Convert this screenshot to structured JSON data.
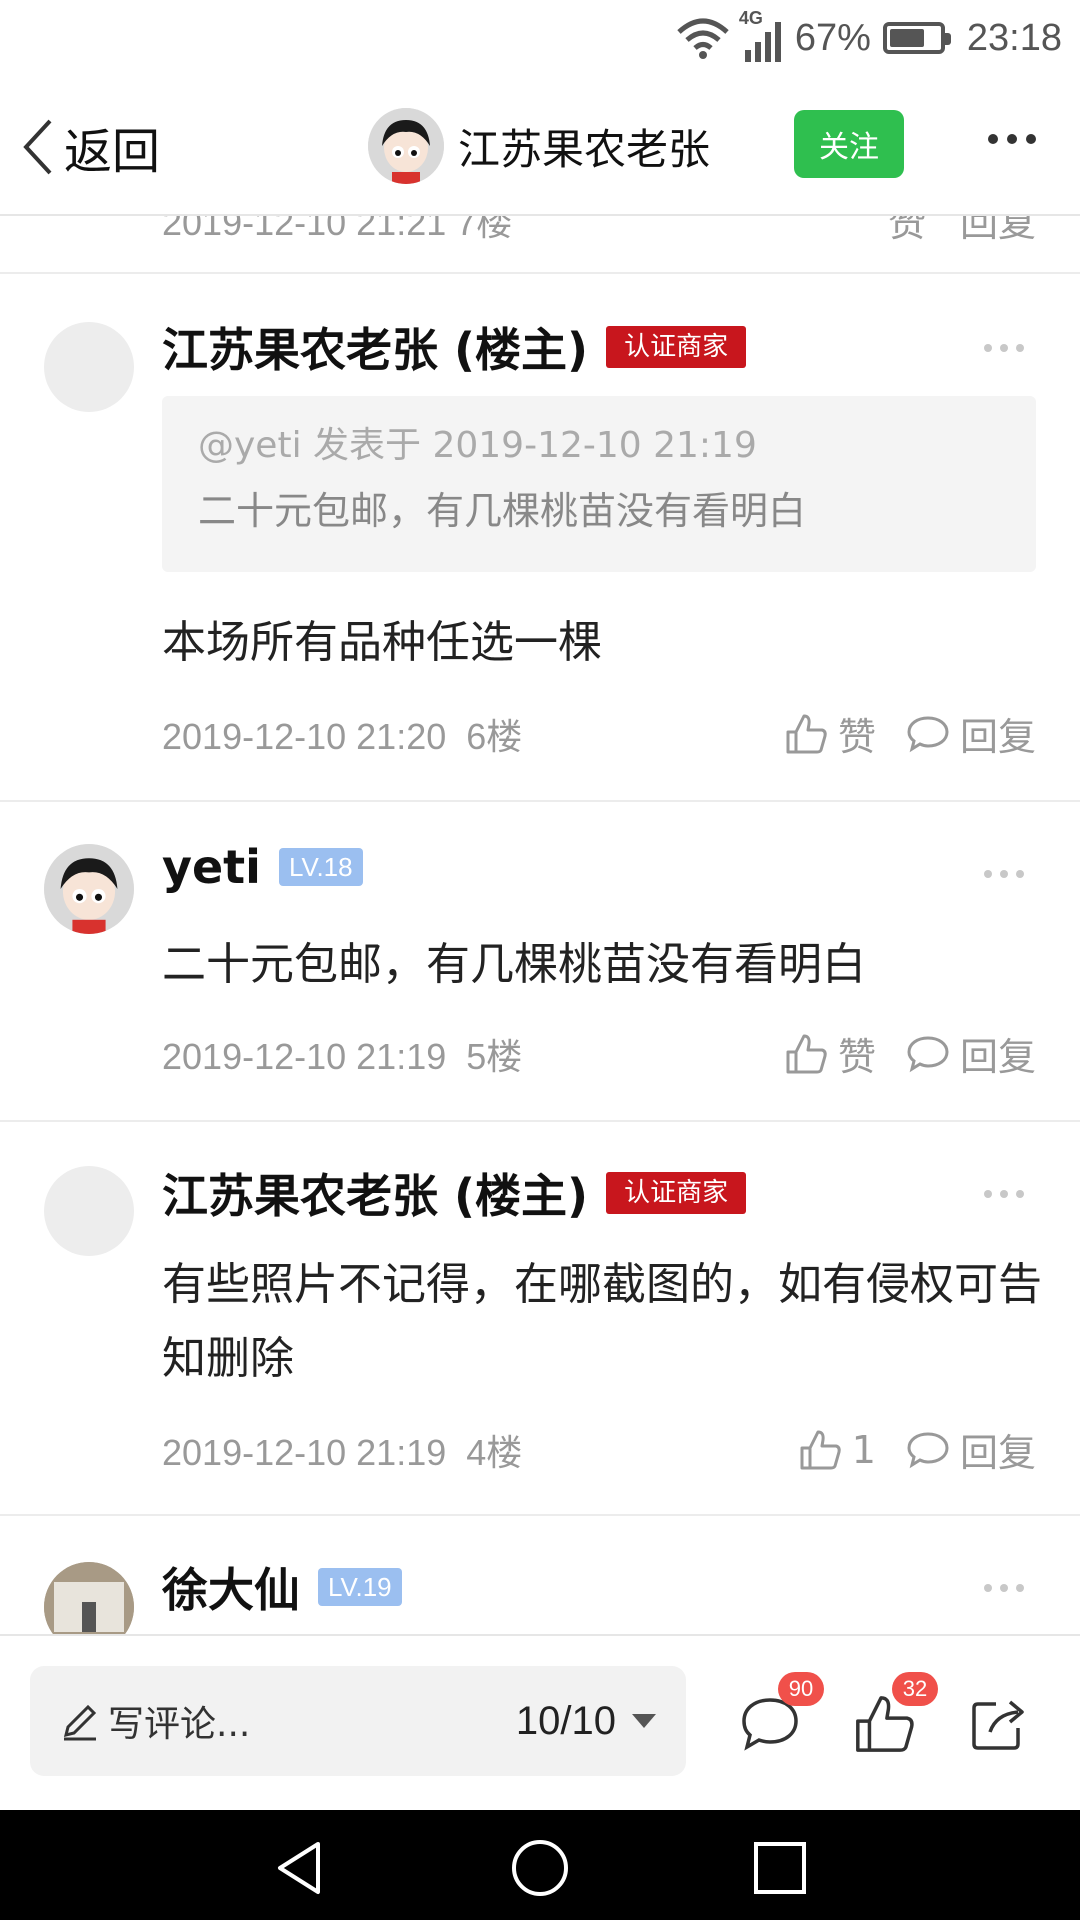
{
  "status_bar": {
    "network": "4G",
    "battery": "67%",
    "battery_level": 0.67,
    "time": "23:18"
  },
  "header": {
    "back_label": "返回",
    "user_name": "江苏果农老张",
    "follow_label": "关注"
  },
  "partial_row": {
    "time": "2019-12-10 21:21 7楼",
    "like": "赞",
    "reply": "回复"
  },
  "comments": [
    {
      "name": "江苏果农老张 (楼主)",
      "badge": "认证商家",
      "quote_meta": "@yeti 发表于 2019-12-10 21:19",
      "quote_text": "二十元包邮，有几棵桃苗没有看明白",
      "content": "本场所有品种任选一棵",
      "time": "2019-12-10 21:20",
      "floor": "6楼",
      "like": "赞",
      "reply": "回复"
    },
    {
      "name": "yeti",
      "badge": "LV.18",
      "content": "二十元包邮，有几棵桃苗没有看明白",
      "time": "2019-12-10 21:19",
      "floor": "5楼",
      "like": "赞",
      "reply": "回复"
    },
    {
      "name": "江苏果农老张 (楼主)",
      "badge": "认证商家",
      "content": "有些照片不记得，在哪截图的，如有侵权可告知删除",
      "time": "2019-12-10 21:19",
      "floor": "4楼",
      "like": "1",
      "reply": "回复"
    },
    {
      "name": "徐大仙",
      "badge": "LV.19"
    }
  ],
  "bottom_bar": {
    "placeholder": "写评论...",
    "pager": "10/10",
    "comment_count": "90",
    "like_count": "32"
  },
  "colors": {
    "follow": "#2fbf4f",
    "merchant_badge": "#c8161d",
    "level_badge": "#9bbff0",
    "count_badge": "#f0504a"
  },
  "icons": [
    "wifi-icon",
    "signal-icon",
    "battery-icon",
    "back-chevron-icon",
    "more-icon",
    "thumbs-up-icon",
    "speech-bubble-icon",
    "pencil-icon",
    "dropdown-caret-icon",
    "share-icon",
    "nav-back-icon",
    "nav-home-icon",
    "nav-recent-icon"
  ]
}
